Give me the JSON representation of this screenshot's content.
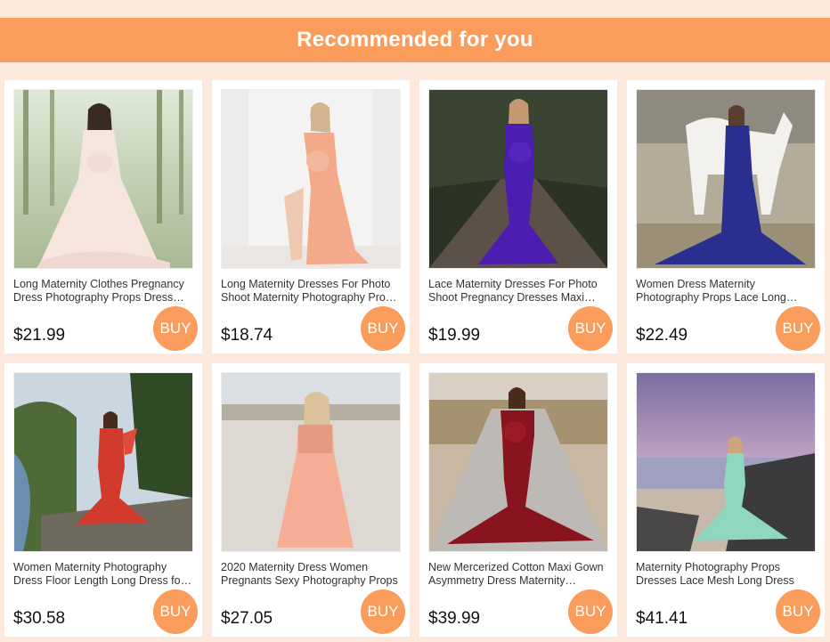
{
  "header": {
    "title": "Recommended for you"
  },
  "colors": {
    "accent": "#fa9c5b",
    "background": "#fde9db",
    "card": "#ffffff"
  },
  "products": [
    {
      "title": "Long Maternity Clothes Pregnancy Dress Photography Props Dress Sexy Lace",
      "price": "$21.99",
      "buy_label": "BUY",
      "image": "cream-lace-gown-forest"
    },
    {
      "title": "Long Maternity Dresses For Photo Shoot Maternity Photography Props Dress",
      "price": "$18.74",
      "buy_label": "BUY",
      "image": "peach-chiffon-gown-studio"
    },
    {
      "title": "Lace Maternity Dresses For Photo Shoot Pregnancy Dresses Maxi Gown",
      "price": "$19.99",
      "buy_label": "BUY",
      "image": "purple-lace-mermaid-road"
    },
    {
      "title": "Women Dress Maternity Photography Props Lace Long Dress",
      "price": "$22.49",
      "buy_label": "BUY",
      "image": "navy-gown-white-horse"
    },
    {
      "title": "Women Maternity Photography Dress Floor Length Long Dress for Photo",
      "price": "$30.58",
      "buy_label": "BUY",
      "image": "red-gown-cliff"
    },
    {
      "title": "2020 Maternity Dress Women Pregnants Sexy Photography Props",
      "price": "$27.05",
      "buy_label": "BUY",
      "image": "pink-sequin-gown-beach"
    },
    {
      "title": "New Mercerized Cotton Maxi Gown Asymmetry Dress Maternity Photography",
      "price": "$39.99",
      "buy_label": "BUY",
      "image": "burgundy-mermaid-road"
    },
    {
      "title": "Maternity Photography Props Dresses Lace Mesh Long Dress",
      "price": "$41.41",
      "buy_label": "BUY",
      "image": "mint-tulle-gown-seaside"
    }
  ]
}
